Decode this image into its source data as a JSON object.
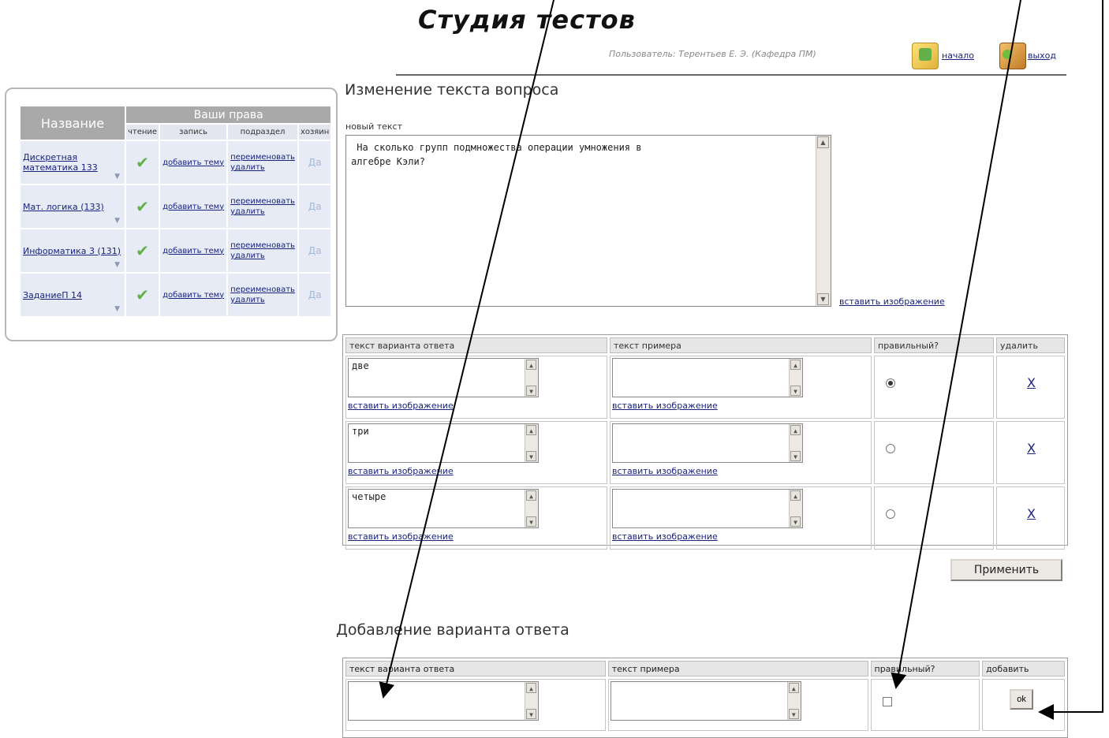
{
  "app": {
    "title": "Студия тестов"
  },
  "header": {
    "user_text": "Пользователь: Терентьев Е. Э. (Кафедра ПМ)",
    "home_label": "начало",
    "exit_label": "выход"
  },
  "courses": {
    "col_name": "Название",
    "col_rights": "Ваши права",
    "sub_read": "чтение",
    "sub_write": "запись",
    "sub_sub": "подраздел",
    "sub_own": "хозяин",
    "rows": [
      {
        "name": "Дискретная математика 133",
        "link1": "добавить тему",
        "link2": "переименовать",
        "link3": "удалить",
        "own": "Да"
      },
      {
        "name": "Мат. логика (133)",
        "link1": "добавить тему",
        "link2": "переименовать",
        "link3": "удалить",
        "own": "Да"
      },
      {
        "name": "Информатика 3 (131)",
        "link1": "добавить тему",
        "link2": "переименовать",
        "link3": "удалить",
        "own": "Да"
      },
      {
        "name": "ЗаданиеП 14",
        "link1": "добавить тему",
        "link2": "переименовать",
        "link3": "удалить",
        "own": "Да"
      }
    ]
  },
  "question": {
    "section_title": "Изменение текста вопроса",
    "label": "новый текст",
    "text": " На сколько групп подмножества операции умножения в\nалгебре Кэли?",
    "insert_image": "вставить изображение"
  },
  "answers": {
    "headers": [
      "текст варианта ответа",
      "текст примера",
      "правильный?",
      "удалить"
    ],
    "rows": [
      {
        "answer": "две",
        "example": "",
        "answer_link": "вставить изображение",
        "example_link": "вставить изображение",
        "correct": true,
        "delete": "X"
      },
      {
        "answer": "три",
        "example": "",
        "answer_link": "вставить изображение",
        "example_link": "вставить изображение",
        "correct": false,
        "delete": "X"
      },
      {
        "answer": "четыре",
        "example": "",
        "answer_link": "вставить изображение",
        "example_link": "вставить изображение",
        "correct": false,
        "delete": "X"
      }
    ],
    "apply_label": "Применить"
  },
  "add_answer": {
    "section_title": "Добавление варианта ответа",
    "headers": [
      "текст варианта ответа",
      "текст примера",
      "правильный?",
      "добавить"
    ],
    "ok_label": "ok"
  }
}
